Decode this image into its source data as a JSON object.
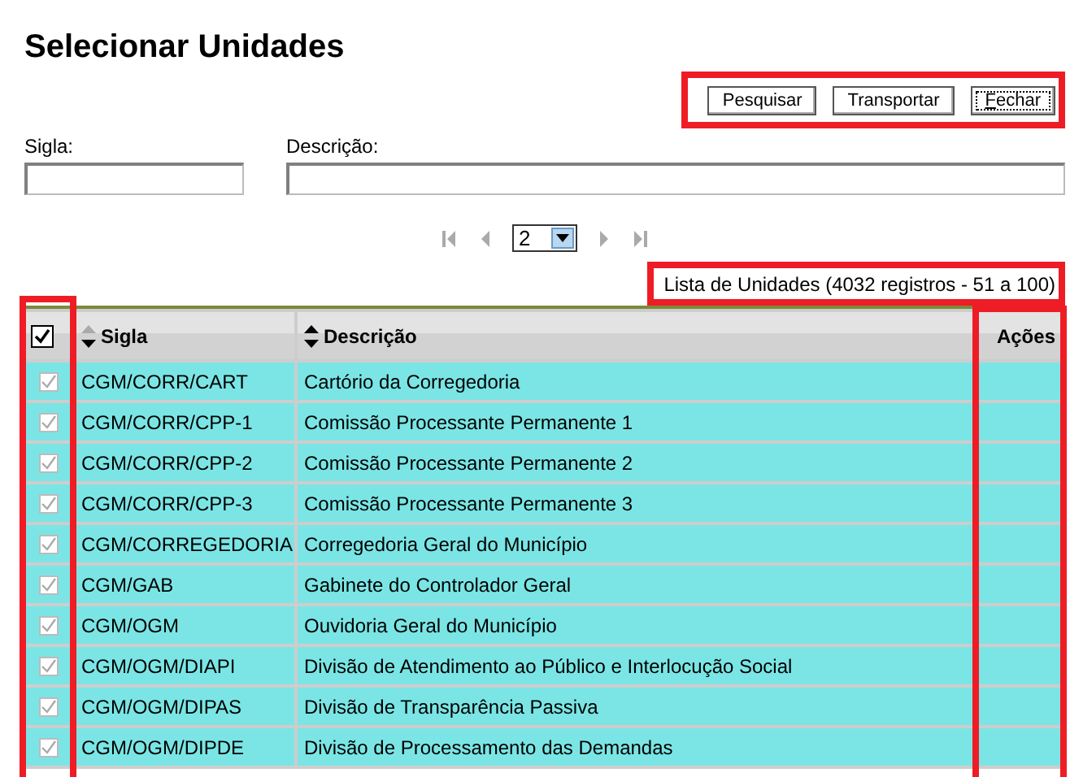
{
  "title": "Selecionar Unidades",
  "toolbar": {
    "highlighted": true,
    "buttons": [
      {
        "label": "Pesquisar",
        "focused": false
      },
      {
        "label": "Transportar",
        "focused": false
      },
      {
        "label": "Fechar",
        "focused": true
      }
    ]
  },
  "filters": [
    {
      "label": "Sigla:",
      "kind": "short"
    },
    {
      "label": "Descrição:",
      "kind": "wide"
    }
  ],
  "pager": {
    "page": "2"
  },
  "count": {
    "text": "Lista de Unidades (4032 registros - 51 a 100)",
    "highlighted": true
  },
  "table": {
    "select_all": {
      "checked": true,
      "highlighted": true
    },
    "columns": [
      {
        "label": "Sigla",
        "sortable": true,
        "sort_up_active": false,
        "sort_down_active": true
      },
      {
        "label": "Descrição",
        "sortable": true,
        "sort_up_active": true,
        "sort_down_active": true
      },
      {
        "label": "Ações",
        "sortable": false,
        "highlighted": true
      }
    ],
    "rows": [
      {
        "sigla": "CGM/CORR/CART",
        "descricao": "Cartório da Corregedoria",
        "checked": true,
        "disabled": true
      },
      {
        "sigla": "CGM/CORR/CPP-1",
        "descricao": "Comissão Processante Permanente 1",
        "checked": true,
        "disabled": true
      },
      {
        "sigla": "CGM/CORR/CPP-2",
        "descricao": "Comissão Processante Permanente 2",
        "checked": true,
        "disabled": true
      },
      {
        "sigla": "CGM/CORR/CPP-3",
        "descricao": "Comissão Processante Permanente 3",
        "checked": true,
        "disabled": true
      },
      {
        "sigla": "CGM/CORREGEDORIA",
        "descricao": "Corregedoria Geral do Município",
        "checked": true,
        "disabled": true
      },
      {
        "sigla": "CGM/GAB",
        "descricao": "Gabinete do Controlador Geral",
        "checked": true,
        "disabled": true
      },
      {
        "sigla": "CGM/OGM",
        "descricao": "Ouvidoria Geral do Município",
        "checked": true,
        "disabled": true
      },
      {
        "sigla": "CGM/OGM/DIAPI",
        "descricao": "Divisão de Atendimento ao Público e Interlocução Social",
        "checked": true,
        "disabled": true
      },
      {
        "sigla": "CGM/OGM/DIPAS",
        "descricao": "Divisão de Transparência Passiva",
        "checked": true,
        "disabled": true
      },
      {
        "sigla": "CGM/OGM/DIPDE",
        "descricao": "Divisão de Processamento das Demandas",
        "checked": true,
        "disabled": true
      }
    ]
  }
}
